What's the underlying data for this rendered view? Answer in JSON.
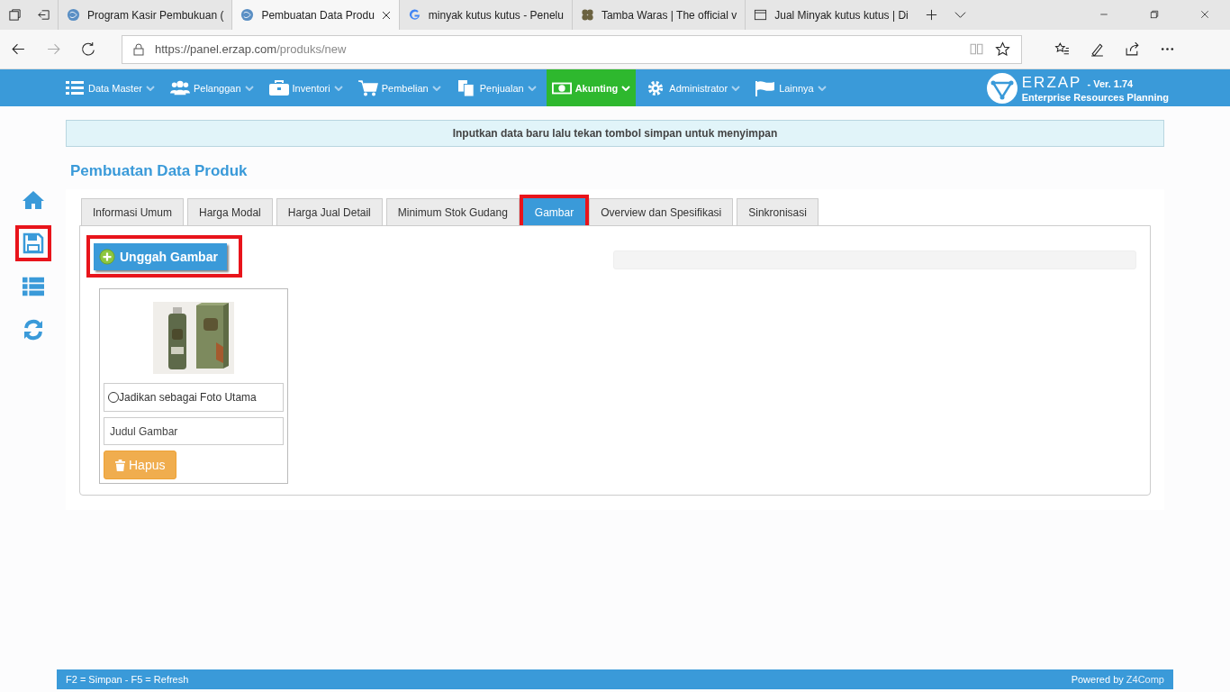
{
  "browser": {
    "tabs": [
      {
        "title": "Program Kasir Pembukuan (",
        "selected": false
      },
      {
        "title": "Pembuatan Data Produ",
        "selected": true
      },
      {
        "title": "minyak kutus kutus - Penelu",
        "selected": false
      },
      {
        "title": "Tamba Waras | The official v",
        "selected": false
      },
      {
        "title": "Jual Minyak kutus kutus | Di",
        "selected": false
      }
    ],
    "url_host": "https://panel.erzap.com",
    "url_path": "/produks/new"
  },
  "navbar": {
    "items": [
      {
        "label": "Data Master",
        "selected": false
      },
      {
        "label": "Pelanggan",
        "selected": false
      },
      {
        "label": "Inventori",
        "selected": false
      },
      {
        "label": "Pembelian",
        "selected": false
      },
      {
        "label": "Penjualan",
        "selected": false
      },
      {
        "label": "Akunting",
        "selected": true
      },
      {
        "label": "Administrator",
        "selected": false
      },
      {
        "label": "Lainnya",
        "selected": false
      }
    ],
    "logo": "ERZAP",
    "version": "- Ver. 1.74",
    "subtitle": "Enterprise Resources Planning"
  },
  "sidebar": {
    "items": [
      {
        "highlighted": false
      },
      {
        "highlighted": true
      },
      {
        "highlighted": false
      },
      {
        "highlighted": false
      }
    ]
  },
  "notice": "Inputkan data baru lalu tekan tombol simpan untuk menyimpan",
  "page_title": "Pembuatan Data Produk",
  "tabs": [
    {
      "label": "Informasi Umum",
      "selected": false,
      "highlighted": false
    },
    {
      "label": "Harga Modal",
      "selected": false,
      "highlighted": false
    },
    {
      "label": "Harga Jual Detail",
      "selected": false,
      "highlighted": false
    },
    {
      "label": "Minimum Stok Gudang",
      "selected": false,
      "highlighted": false
    },
    {
      "label": "Gambar",
      "selected": true,
      "highlighted": true
    },
    {
      "label": "Overview dan Spesifikasi",
      "selected": false,
      "highlighted": false
    },
    {
      "label": "Sinkronisasi",
      "selected": false,
      "highlighted": false
    }
  ],
  "upload_button": {
    "label": "Unggah Gambar",
    "highlighted": true
  },
  "upload_progress": {
    "level": 0
  },
  "images": [
    {
      "kind": "picture",
      "main_photo_label": "Jadikan sebagai Foto Utama",
      "main_photo": false,
      "title_placeholder": "Judul Gambar",
      "delete_label": "Hapus"
    }
  ],
  "footer": {
    "shortcuts": "F2 = Simpan - F5 = Refresh",
    "powered_by": "Powered by",
    "company": "Z4Comp"
  }
}
